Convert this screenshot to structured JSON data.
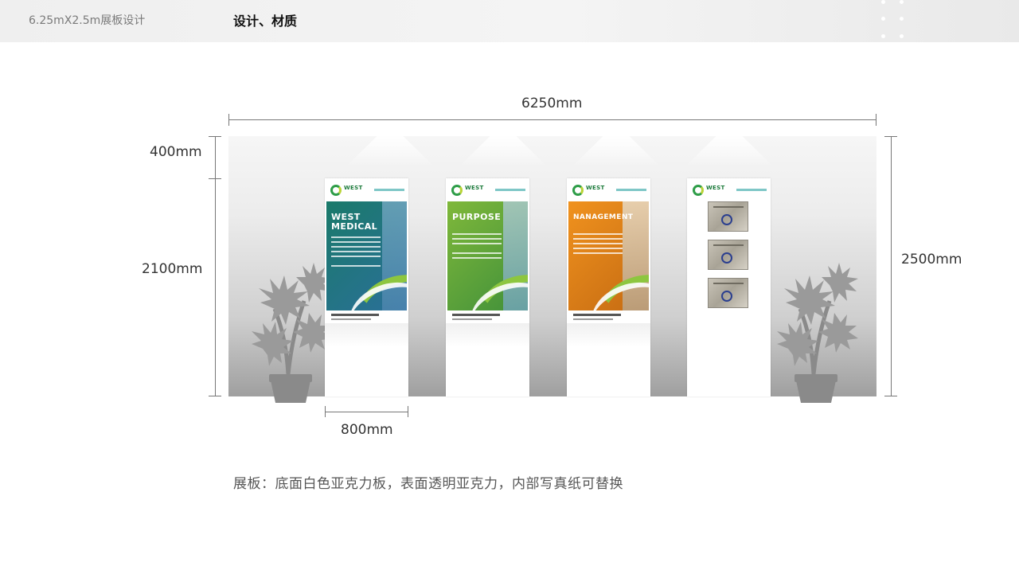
{
  "header": {
    "left_title": "6.25mX2.5m展板设计",
    "right_title": "设计、材质"
  },
  "dimensions": {
    "total_width": "6250mm",
    "top_height": "400mm",
    "panel_height": "2100mm",
    "total_height": "2500mm",
    "panel_width": "800mm"
  },
  "panels": [
    {
      "logo": "WEST",
      "title": "WEST MEDICAL",
      "color_top": "#1a7a6a",
      "color_bottom": "#2b6f9a"
    },
    {
      "logo": "WEST",
      "title": "PURPOSE",
      "color_top": "#7fb83a",
      "color_bottom": "#3f8f3a"
    },
    {
      "logo": "WEST",
      "title": "NANAGEMENT",
      "color_top": "#f0921e",
      "color_bottom": "#c46a12"
    },
    {
      "logo": "WEST",
      "title": "",
      "color_top": "#ffffff",
      "color_bottom": "#ffffff"
    }
  ],
  "caption": "展板：底面白色亚克力板，表面透明亚克力，内部写真纸可替换",
  "icons": {
    "plant": "potted-plant-icon",
    "spotlight": "spotlight-icon",
    "certificate": "certificate-icon"
  }
}
